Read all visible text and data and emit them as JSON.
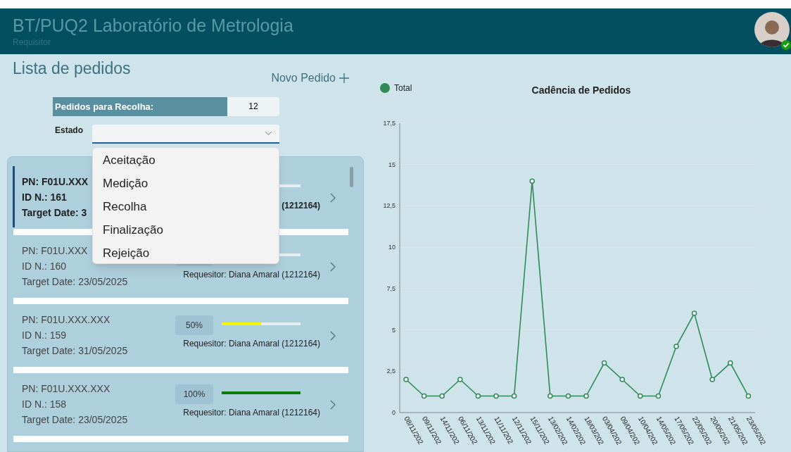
{
  "header": {
    "title": "BT/PUQ2 Laboratório de Metrologia",
    "subtitle": "Requisitor",
    "user_online": true
  },
  "page_title": "Lista de pedidos",
  "new_order_button": {
    "label": "Novo Pedido"
  },
  "pickup_summary": {
    "label": "Pedidos para Recolha:",
    "value": "12"
  },
  "state_filter": {
    "label": "Estado",
    "expanded": true,
    "options": [
      {
        "label": "Aceitação"
      },
      {
        "label": "Medição"
      },
      {
        "label": "Recolha"
      },
      {
        "label": "Finalização"
      },
      {
        "label": "Rejeição"
      }
    ]
  },
  "orders": [
    {
      "pn": "PN: F01U.XXX",
      "id": "ID N.: 161",
      "target_date": "Target Date: 3",
      "requester": "(1212164)",
      "selected": true
    },
    {
      "pn": "PN: F01U.XXX",
      "id": "ID N.: 160",
      "target_date": "Target Date: 23/05/2025",
      "requester": "Requesitor: Diana Amaral (1212164)",
      "selected": false,
      "badge": true
    },
    {
      "pn": "PN: F01U.XXX.XXX",
      "id": "ID N.: 159",
      "target_date": "Target Date: 31/05/2025",
      "percent": "50%",
      "level": 0.5,
      "requester": "Requesitor: Diana Amaral (1212164)",
      "selected": false
    },
    {
      "pn": "PN: F01U.XXX.XXX",
      "id": "ID N.: 158",
      "target_date": "Target Date: 23/05/2025",
      "percent": "100%",
      "level": 1,
      "requester": "Requesitor: Diana Amaral (1212164)",
      "selected": false
    }
  ],
  "chart": {
    "chart_data": {
      "type": "line",
      "title": "Cadência de Pedidos",
      "categories": [
        "08/11/202",
        "09/11/202",
        "14/11/202",
        "06/11/202",
        "13/11/202",
        "11/11/202",
        "12/11/202",
        "15/11/202",
        "13/02/202",
        "14/02/202",
        "18/03/202",
        "03/04/202",
        "09/04/202",
        "10/04/202",
        "14/05/202",
        "17/05/202",
        "22/05/202",
        "20/05/202",
        "21/05/202",
        "23/05/202"
      ],
      "grid": true,
      "series": [
        {
          "name": "Total",
          "color": "#2e8b57",
          "marker": "circle",
          "values": [
            2,
            1,
            1,
            2,
            1,
            1,
            1,
            14,
            1,
            1,
            1,
            3,
            2,
            1,
            1,
            4,
            6,
            2,
            3,
            1
          ]
        }
      ],
      "ylim": [
        0,
        17.5
      ],
      "yticks": [
        {
          "value": 0,
          "label": "0"
        },
        {
          "value": 2.5,
          "label": "2,5"
        },
        {
          "value": 5,
          "label": "5"
        },
        {
          "value": 7.5,
          "label": "7,5"
        },
        {
          "value": 10,
          "label": "10"
        },
        {
          "value": 12.5,
          "label": "12,5"
        },
        {
          "value": 15,
          "label": "15"
        },
        {
          "value": 17.5,
          "label": "17,5"
        }
      ]
    }
  }
}
